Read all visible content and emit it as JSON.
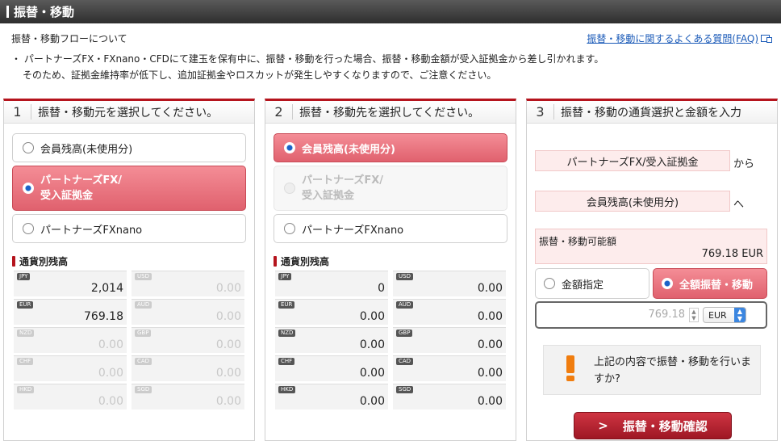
{
  "header": {
    "title": "振替・移動"
  },
  "flow_title": "振替・移動フローについて",
  "faq_link": "振替・移動に関するよくある質問(FAQ)",
  "notice": {
    "line1": "・ パートナーズFX・FXnano・CFDにて建玉を保有中に、振替・移動を行った場合、振替・移動金額が受入証拠金から差し引かれます。",
    "line2": "そのため、証拠金維持率が低下し、追加証拠金やロスカットが発生しやすくなりますので、ご注意ください。"
  },
  "panel1": {
    "num": "1",
    "title": "振替・移動元を選択してください。",
    "options": [
      {
        "label": "会員残高(未使用分)",
        "state": "normal"
      },
      {
        "label": "パートナーズFX/",
        "label2": "受入証拠金",
        "state": "selected"
      },
      {
        "label": "パートナーズFXnano",
        "state": "normal"
      }
    ],
    "balance_label": "通貨別残高",
    "balances": [
      {
        "code": "JPY",
        "amount": "2,014"
      },
      {
        "code": "USD",
        "amount": "0.00"
      },
      {
        "code": "EUR",
        "amount": "769.18"
      },
      {
        "code": "AUD",
        "amount": "0.00"
      },
      {
        "code": "NZD",
        "amount": "0.00"
      },
      {
        "code": "GBP",
        "amount": "0.00"
      },
      {
        "code": "CHF",
        "amount": "0.00"
      },
      {
        "code": "CAD",
        "amount": "0.00"
      },
      {
        "code": "HKD",
        "amount": "0.00"
      },
      {
        "code": "SGD",
        "amount": "0.00"
      }
    ]
  },
  "panel2": {
    "num": "2",
    "title": "振替・移動先を選択してください。",
    "options": [
      {
        "label": "会員残高(未使用分)",
        "state": "selected"
      },
      {
        "label": "パートナーズFX/",
        "label2": "受入証拠金",
        "state": "disabled"
      },
      {
        "label": "パートナーズFXnano",
        "state": "normal"
      }
    ],
    "balance_label": "通貨別残高",
    "balances": [
      {
        "code": "JPY",
        "amount": "0"
      },
      {
        "code": "USD",
        "amount": "0.00"
      },
      {
        "code": "EUR",
        "amount": "0.00"
      },
      {
        "code": "AUD",
        "amount": "0.00"
      },
      {
        "code": "NZD",
        "amount": "0.00"
      },
      {
        "code": "GBP",
        "amount": "0.00"
      },
      {
        "code": "CHF",
        "amount": "0.00"
      },
      {
        "code": "CAD",
        "amount": "0.00"
      },
      {
        "code": "HKD",
        "amount": "0.00"
      },
      {
        "code": "SGD",
        "amount": "0.00"
      }
    ]
  },
  "panel3": {
    "num": "3",
    "title": "振替・移動の通貨選択と金額を入力",
    "from": "パートナーズFX/受入証拠金",
    "from_suffix": "から",
    "to": "会員残高(未使用分)",
    "to_suffix": "へ",
    "available_label": "振替・移動可能額",
    "available_value": "769.18 EUR",
    "amount_specify": "金額指定",
    "amount_full": "全額振替・移動",
    "amount_value": "769.18",
    "currency": "EUR",
    "confirm_message": "上記の内容で振替・移動を行いますか?",
    "confirm_button": "振替・移動確認"
  }
}
